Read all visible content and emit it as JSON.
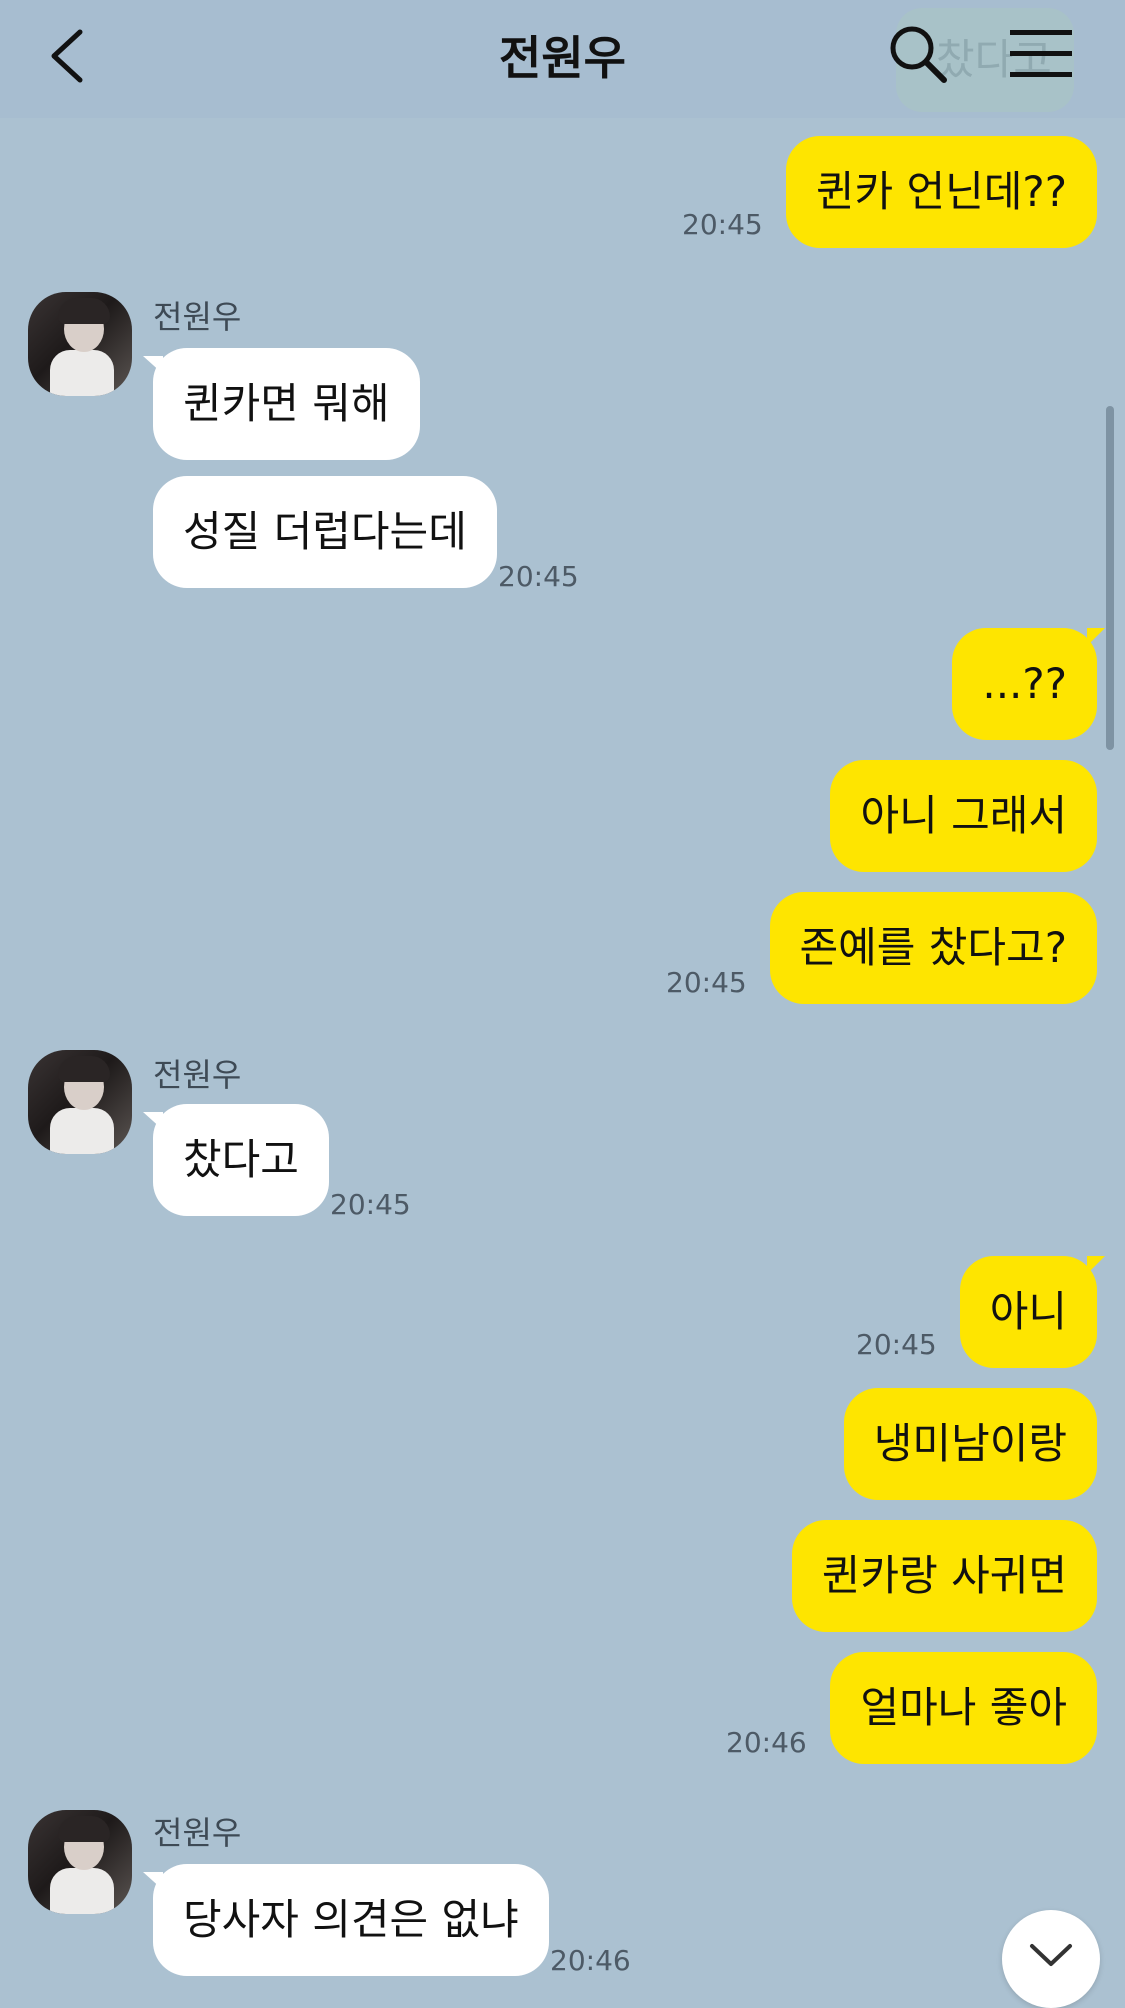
{
  "header": {
    "title": "전원우",
    "back_icon": "chevron-left-icon",
    "search_icon": "search-icon",
    "menu_icon": "hamburger-menu-icon",
    "ghost_text": "찼다고"
  },
  "colors": {
    "background": "#abc1d1",
    "my_bubble": "#fee500",
    "their_bubble": "#ffffff"
  },
  "contact": {
    "name": "전원우"
  },
  "messages": [
    {
      "from": "me",
      "text": "퀸카 언닌데??",
      "time": "20:45"
    },
    {
      "from": "them",
      "sender": "전원우",
      "text": "퀸카면 뭐해"
    },
    {
      "from": "them",
      "text": "성질 더럽다는데",
      "time": "20:45"
    },
    {
      "from": "me",
      "text": "...??"
    },
    {
      "from": "me",
      "text": "아니 그래서"
    },
    {
      "from": "me",
      "text": "존예를 찼다고?",
      "time": "20:45"
    },
    {
      "from": "them",
      "sender": "전원우",
      "text": "찼다고",
      "time": "20:45"
    },
    {
      "from": "me",
      "text": "아니",
      "time": "20:45"
    },
    {
      "from": "me",
      "text": "냉미남이랑"
    },
    {
      "from": "me",
      "text": "퀸카랑 사귀면"
    },
    {
      "from": "me",
      "text": "얼마나 좋아",
      "time": "20:46"
    },
    {
      "from": "them",
      "sender": "전원우",
      "text": "당사자 의견은 없냐",
      "time": "20:46"
    }
  ]
}
